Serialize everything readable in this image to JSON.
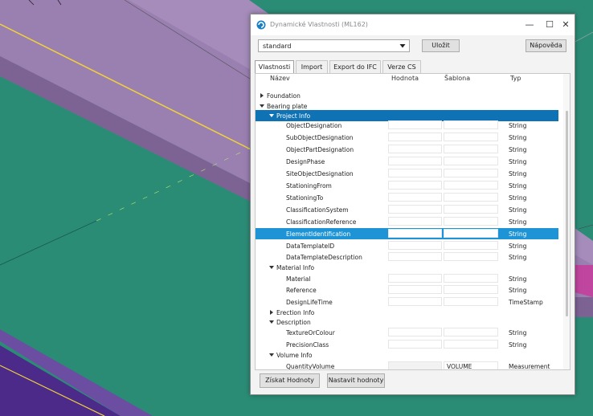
{
  "window": {
    "title": "Dynamické Vlastnosti (ML162)",
    "minimize": "—",
    "maximize": "☐",
    "close": "✕"
  },
  "toolbar": {
    "template_value": "standard",
    "save_label": "Uložit",
    "help_label": "Nápověda"
  },
  "tabs": [
    {
      "label": "Vlastnosti",
      "active": true
    },
    {
      "label": "Import",
      "active": false
    },
    {
      "label": "Export do IFC",
      "active": false
    },
    {
      "label": "Verze CS",
      "active": false
    }
  ],
  "columns": {
    "name": "Název",
    "value": "Hodnota",
    "template": "Šablona",
    "type": "Typ"
  },
  "rows": [
    {
      "label": "Foundation",
      "level": 0,
      "kind": "group",
      "expanded": false
    },
    {
      "label": "Bearing plate",
      "level": 0,
      "kind": "group",
      "expanded": true
    },
    {
      "label": "Project Info",
      "level": 1,
      "kind": "group",
      "expanded": true,
      "state": "highlight"
    },
    {
      "label": "ObjectDesignation",
      "kind": "prop",
      "type": "String"
    },
    {
      "label": "SubObjectDesignation",
      "kind": "prop",
      "type": "String"
    },
    {
      "label": "ObjectPartDesignation",
      "kind": "prop",
      "type": "String"
    },
    {
      "label": "DesignPhase",
      "kind": "prop",
      "type": "String"
    },
    {
      "label": "SiteObjectDesignation",
      "kind": "prop",
      "type": "String"
    },
    {
      "label": "StationingFrom",
      "kind": "prop",
      "type": "String"
    },
    {
      "label": "StationingTo",
      "kind": "prop",
      "type": "String"
    },
    {
      "label": "ClassificationSystem",
      "kind": "prop",
      "type": "String"
    },
    {
      "label": "ClassificationReference",
      "kind": "prop",
      "type": "String"
    },
    {
      "label": "ElementIdentification",
      "kind": "prop",
      "type": "String",
      "state": "selected"
    },
    {
      "label": "DataTemplateID",
      "kind": "prop",
      "type": "String"
    },
    {
      "label": "DataTemplateDescription",
      "kind": "prop",
      "type": "String"
    },
    {
      "label": "Material Info",
      "level": 1,
      "kind": "group",
      "expanded": true
    },
    {
      "label": "Material",
      "kind": "prop",
      "type": "String"
    },
    {
      "label": "Reference",
      "kind": "prop",
      "type": "String"
    },
    {
      "label": "DesignLifeTime",
      "kind": "prop",
      "type": "TimeStamp"
    },
    {
      "label": "Erection Info",
      "level": 1,
      "kind": "group",
      "expanded": false
    },
    {
      "label": "Description",
      "level": 1,
      "kind": "group",
      "expanded": true
    },
    {
      "label": "TextureOrColour",
      "kind": "prop",
      "type": "String"
    },
    {
      "label": "PrecisionClass",
      "kind": "prop",
      "type": "String"
    },
    {
      "label": "Volume Info",
      "level": 1,
      "kind": "group",
      "expanded": true
    },
    {
      "label": "QuantityVolume",
      "kind": "prop",
      "type": "Measurement",
      "template": "VOLUME",
      "value_disabled": true
    }
  ],
  "footer": {
    "get_values_label": "Získat Hodnoty",
    "set_values_label": "Nastavit hodnoty"
  }
}
